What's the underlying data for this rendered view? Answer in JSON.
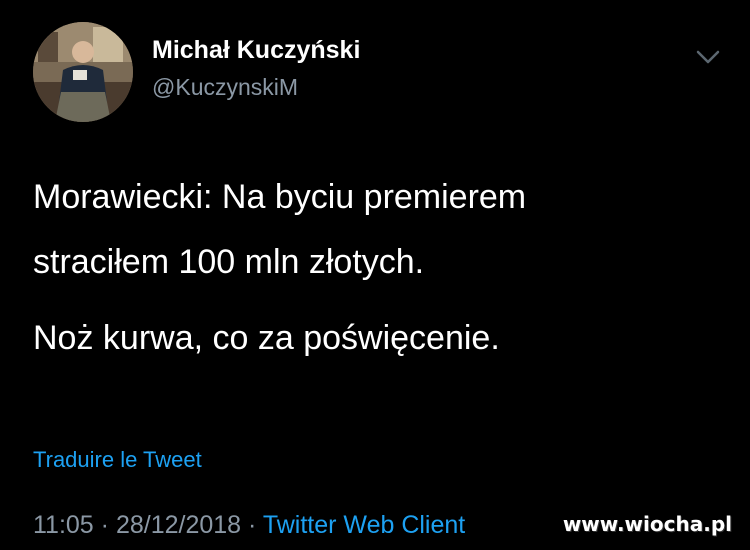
{
  "author": {
    "name": "Michał Kuczyński",
    "handle": "@KuczynskiM",
    "avatar_icon": "profile-photo"
  },
  "tweet": {
    "lines": [
      "Morawiecki: Na byciu premierem",
      "straciłem 100 mln złotych.",
      "Noż kurwa, co za poświęcenie."
    ],
    "translate_label": "Traduire le Tweet"
  },
  "meta": {
    "time": "11:05",
    "separator": "·",
    "date": "28/12/2018",
    "client": "Twitter Web Client"
  },
  "watermark": "www.wiocha.pl",
  "colors": {
    "background": "#000000",
    "text": "#ffffff",
    "secondary": "#8b98a5",
    "link": "#1da1f2"
  },
  "icons": {
    "more": "chevron-down-icon"
  }
}
